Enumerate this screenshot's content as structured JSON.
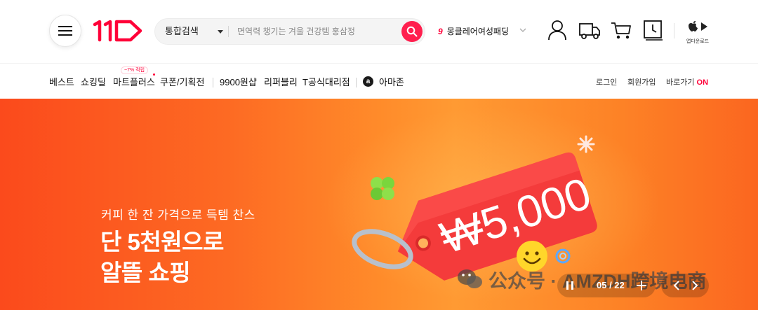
{
  "header": {
    "logo_text": "11번가",
    "search": {
      "scope": "통합검색",
      "placeholder": "면역력 챙기는 겨울 건강템 홍삼정"
    },
    "trending": {
      "rank": "9",
      "keyword": "몽클레어여성패딩"
    },
    "icons": [
      "hamburger-menu-icon",
      "user-icon",
      "delivery-truck-icon",
      "cart-icon",
      "recent-view-icon",
      "app-download-icon"
    ],
    "app_download_label": "앱다운로드"
  },
  "nav": {
    "items": [
      "베스트",
      "쇼킹딜",
      "마트플러스",
      "쿠폰/기획전",
      "9900원샵",
      "리퍼블리",
      "T공식대리점",
      "아마존"
    ],
    "badge": "~7% 적립",
    "utility": {
      "login": "로그인",
      "signup": "회원가입",
      "shortcut": "바로가기",
      "shortcut_state": "ON"
    }
  },
  "banner": {
    "subtitle": "커피 한 잔 가격으로 득템 찬스",
    "title_line1": "단 5천원으로",
    "title_line2": "알뜰 쇼핑",
    "price_tag": "₩5,000",
    "counter": "05 / 22",
    "watermark": "公众号 · AMZDH跨境电商"
  },
  "colors": {
    "brand_red": "#ff0038",
    "search_button": "#ff1f4e",
    "banner_orange": "#fd7a26"
  }
}
